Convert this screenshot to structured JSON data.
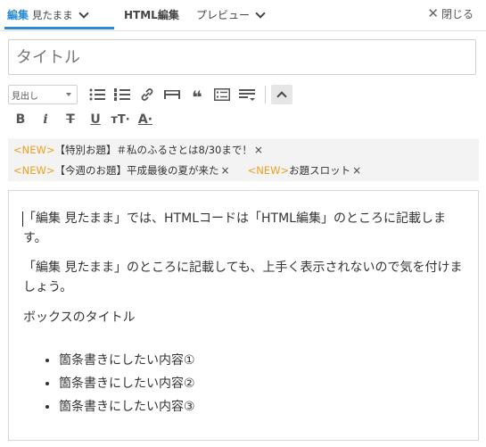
{
  "tabs": {
    "edit_label": "編集",
    "edit_mode": "見たまま",
    "html_label": "HTML編集",
    "preview_label": "プレビュー",
    "close_label": "閉じる"
  },
  "title_placeholder": "タイトル",
  "toolbar": {
    "heading_select": "見出し"
  },
  "tags": [
    {
      "new": "<NEW>",
      "text": "【特別お題】＃私のふるさとは8/30まで！",
      "x": "×"
    },
    {
      "new": "<NEW>",
      "text": "【今週のお題】平成最後の夏が来た",
      "x": "×"
    },
    {
      "new": "<NEW>",
      "text": "お題スロット",
      "x": "×"
    }
  ],
  "editor": {
    "p1": "「編集 見たまま」では、HTMLコードは「HTML編集」のところに記載します。",
    "p2": "「編集 見たまま」のところに記載しても、上手く表示されないので気を付けましょう。",
    "p3": "ボックスのタイトル",
    "items": [
      "箇条書きにしたい内容①",
      "箇条書きにしたい内容②",
      "箇条書きにしたい内容③"
    ]
  },
  "colors": {
    "accent": "#2a8ad3",
    "new_tag": "#f0a020"
  }
}
